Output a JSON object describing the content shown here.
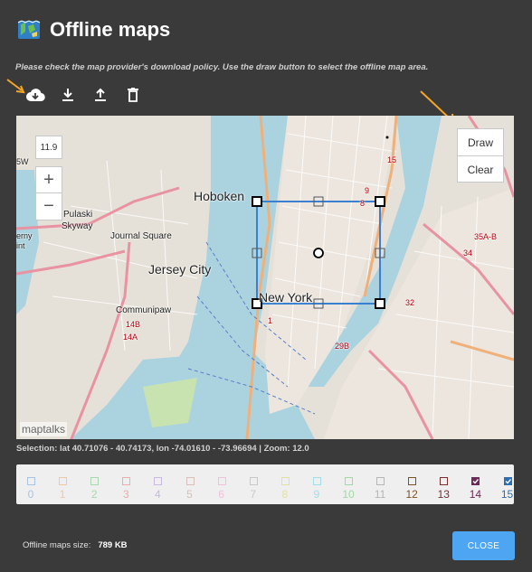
{
  "dialog": {
    "title": "Offline maps",
    "instructions": "Please check the map provider's download policy. Use the draw button to select the offline map area."
  },
  "toolbar": {
    "icons": [
      "cloud-download-icon",
      "download-icon",
      "upload-icon",
      "trash-icon"
    ]
  },
  "map": {
    "zoom_value": "11.9",
    "zoom_in": "+",
    "zoom_out": "−",
    "draw_label": "Draw",
    "clear_label": "Clear",
    "attribution": "maptalks",
    "labels": {
      "hoboken": "Hoboken",
      "jersey_city": "Jersey City",
      "new_york": "New York",
      "journal_square": "Journal Square",
      "communipaw": "Communipaw",
      "pulaski_1": "Pulaski",
      "pulaski_2": "Skyway",
      "5w": "5W",
      "eny_1": "erny",
      "eny_2": "int",
      "r35ab": "35A-B",
      "r34": "34",
      "r14b": "14B",
      "r14a": "14A",
      "r15": "15",
      "r9": "9",
      "r8": "8",
      "r32": "32",
      "r29b": "29B",
      "r1": "1"
    }
  },
  "selection_text": "Selection: lat 40.71076 - 40.74173, lon -74.01610 - -73.96694 | Zoom: 12.0",
  "zoom_levels": [
    {
      "label": "0",
      "checked": false,
      "color": "#a9c4e3"
    },
    {
      "label": "1",
      "checked": false,
      "color": "#f1c9a0"
    },
    {
      "label": "2",
      "checked": false,
      "color": "#a7d8ab"
    },
    {
      "label": "3",
      "checked": false,
      "color": "#f0aaaa"
    },
    {
      "label": "4",
      "checked": false,
      "color": "#c9b8e2"
    },
    {
      "label": "5",
      "checked": false,
      "color": "#d9bfb8"
    },
    {
      "label": "6",
      "checked": false,
      "color": "#f0c0dc"
    },
    {
      "label": "7",
      "checked": false,
      "color": "#c8c8c8"
    },
    {
      "label": "8",
      "checked": false,
      "color": "#e2e2a0"
    },
    {
      "label": "9",
      "checked": false,
      "color": "#a3dde8"
    },
    {
      "label": "10",
      "checked": false,
      "color": "#9fdaa3"
    },
    {
      "label": "11",
      "checked": false,
      "color": "#b5b5b5"
    },
    {
      "label": "12",
      "checked": false,
      "color": "#7a5325"
    },
    {
      "label": "13",
      "checked": false,
      "color": "#7a2f2f"
    },
    {
      "label": "14",
      "checked": true,
      "color": "#6b2a57"
    },
    {
      "label": "15",
      "checked": true,
      "color": "#2d6db0"
    }
  ],
  "footer": {
    "size_label": "Offline maps size:",
    "size_value": "789 KB",
    "close_label": "CLOSE"
  },
  "colors": {
    "background": "#3a3a3a",
    "accent": "#4ea6f2",
    "annotation_arrow": "#f5a623",
    "selection_box": "#3b7fd1"
  }
}
